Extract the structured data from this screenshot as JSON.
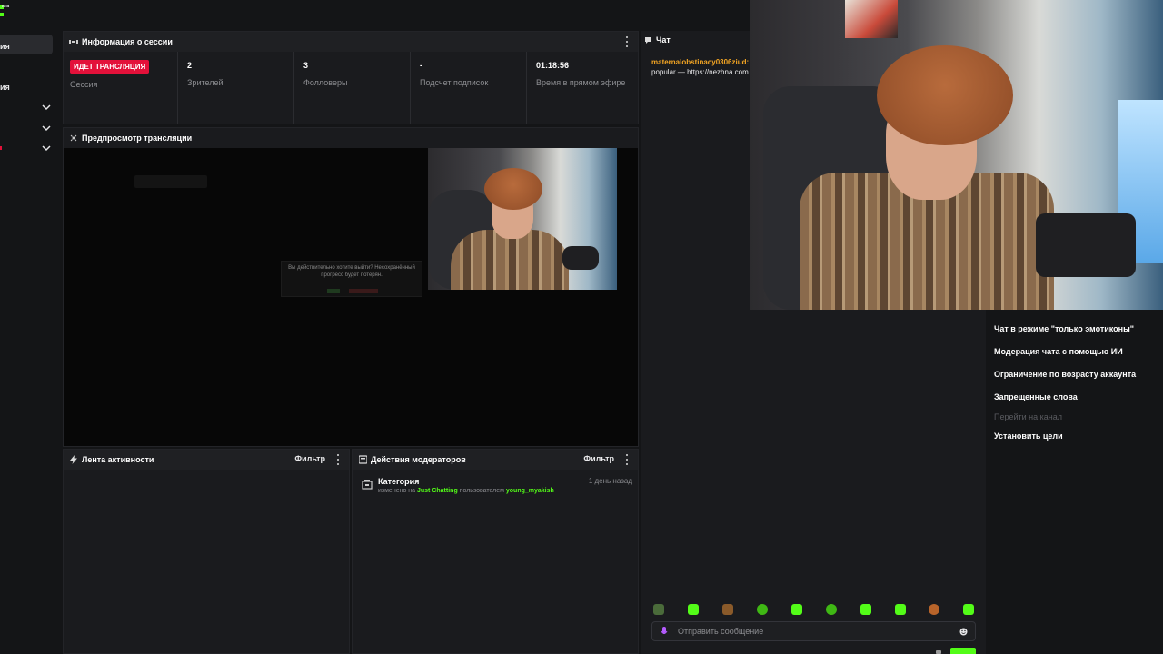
{
  "sidebar": {
    "top_label": "ата",
    "items": [
      {
        "label": "ия"
      },
      {
        "label": "ия"
      }
    ]
  },
  "session_info": {
    "title": "Информация о сессии",
    "live_badge": "ИДЕТ ТРАНСЛЯЦИЯ",
    "session_label": "Сессия",
    "stats": [
      {
        "value": "2",
        "label": "Зрителей"
      },
      {
        "value": "3",
        "label": "Фолловеры"
      },
      {
        "value": "-",
        "label": "Подсчет подписок"
      },
      {
        "value": "01:18:56",
        "label": "Время в прямом эфире"
      }
    ]
  },
  "preview": {
    "title": "Предпросмотр трансляции",
    "dialog_text": "Вы действительно хотите выйти? Несохранённый прогресс будет потерян."
  },
  "activity_feed": {
    "title": "Лента активности",
    "filter_label": "Фильтр"
  },
  "mod_actions": {
    "title": "Действия модераторов",
    "filter_label": "Фильтр",
    "items": [
      {
        "title": "Категория",
        "time": "1 день назад",
        "prefix": "изменено на",
        "category": "Just Chatting",
        "middle": "пользователем",
        "user": "young_myakish"
      }
    ]
  },
  "chat": {
    "title": "Чат",
    "messages": [
      {
        "user": "maternalobstinacy0306ziud:",
        "text": "popular — https://nezhna.com"
      }
    ],
    "input_placeholder": "Отправить сообщение"
  },
  "chat_settings": {
    "options": [
      "Чат в режиме \"только эмотиконы\"",
      "Модерация чата с помощью ИИ",
      "Ограничение по возрасту аккаунта",
      "Запрещенные слова",
      "Перейти на канал",
      "Установить цели"
    ]
  },
  "colors": {
    "accent_green": "#53fc18",
    "live_red": "#e3113a",
    "chat_user": "#f5a623",
    "panel_bg": "#1a1b1e"
  }
}
